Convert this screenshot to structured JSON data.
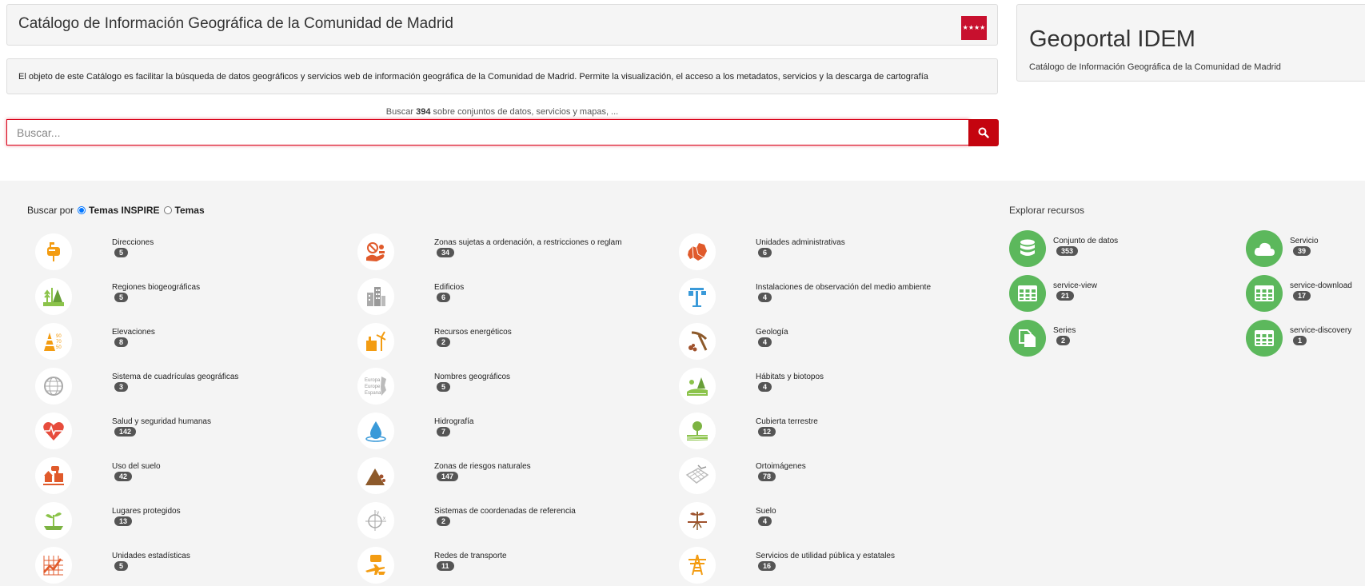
{
  "header": {
    "title": "Catálogo de Información Geográfica de la Comunidad de Madrid",
    "description": "El objeto de este Catálogo es facilitar la búsqueda de datos geográficos y servicios web de información geográfica de la Comunidad de Madrid. Permite la visualización, el acceso a los metadatos, servicios y la descarga de cartografía"
  },
  "geoportal": {
    "title": "Geoportal IDEM",
    "subtitle": "Catálogo de Información Geográfica de la Comunidad de Madrid"
  },
  "search": {
    "count_prefix": "Buscar",
    "count": "394",
    "count_suffix": "sobre conjuntos de datos, servicios y mapas, ...",
    "placeholder": "Buscar..."
  },
  "search_by": {
    "label": "Buscar por",
    "option_inspire": "Temas INSPIRE",
    "option_temas": "Temas"
  },
  "themes": [
    {
      "label": "Direcciones",
      "count": "5",
      "icon": "mailbox-icon"
    },
    {
      "label": "Zonas sujetas a ordenación, a restricciones o reglam",
      "count": "34",
      "icon": "restricted-zone-icon"
    },
    {
      "label": "Unidades administrativas",
      "count": "6",
      "icon": "admin-map-icon"
    },
    {
      "label": "Regiones biogeográficas",
      "count": "5",
      "icon": "biogeo-regions-icon"
    },
    {
      "label": "Edificios",
      "count": "6",
      "icon": "buildings-icon"
    },
    {
      "label": "Instalaciones de observación del medio ambiente",
      "count": "4",
      "icon": "observation-station-icon"
    },
    {
      "label": "Elevaciones",
      "count": "8",
      "icon": "elevation-icon"
    },
    {
      "label": "Recursos energéticos",
      "count": "2",
      "icon": "energy-icon"
    },
    {
      "label": "Geología",
      "count": "4",
      "icon": "pickaxe-icon"
    },
    {
      "label": "Sistema de cuadrículas geográficas",
      "count": "3",
      "icon": "grid-globe-icon"
    },
    {
      "label": "Nombres geográficos",
      "count": "5",
      "icon": "geo-names-icon"
    },
    {
      "label": "Hábitats y biotopos",
      "count": "4",
      "icon": "habitat-icon"
    },
    {
      "label": "Salud y seguridad humanas",
      "count": "142",
      "icon": "heart-icon"
    },
    {
      "label": "Hidrografía",
      "count": "7",
      "icon": "water-drop-icon"
    },
    {
      "label": "Cubierta terrestre",
      "count": "12",
      "icon": "land-cover-icon"
    },
    {
      "label": "Uso del suelo",
      "count": "42",
      "icon": "land-use-icon"
    },
    {
      "label": "Zonas de riesgos naturales",
      "count": "147",
      "icon": "landslide-icon"
    },
    {
      "label": "Ortoimágenes",
      "count": "78",
      "icon": "orthoimage-icon"
    },
    {
      "label": "Lugares protegidos",
      "count": "13",
      "icon": "protected-plant-icon"
    },
    {
      "label": "Sistemas de coordenadas de referencia",
      "count": "2",
      "icon": "coordinates-icon"
    },
    {
      "label": "Suelo",
      "count": "4",
      "icon": "soil-icon"
    },
    {
      "label": "Unidades estadísticas",
      "count": "5",
      "icon": "statistics-chart-icon"
    },
    {
      "label": "Redes de transporte",
      "count": "11",
      "icon": "transport-icon"
    },
    {
      "label": "Servicios de utilidad pública y estatales",
      "count": "16",
      "icon": "utility-tower-icon"
    }
  ],
  "explore": {
    "title": "Explorar recursos",
    "resources": [
      {
        "label": "Conjunto de datos",
        "count": "353",
        "icon": "database-icon"
      },
      {
        "label": "Servicio",
        "count": "39",
        "icon": "cloud-icon"
      },
      {
        "label": "service-view",
        "count": "21",
        "icon": "table-grid-icon"
      },
      {
        "label": "service-download",
        "count": "17",
        "icon": "table-grid-icon"
      },
      {
        "label": "Series",
        "count": "2",
        "icon": "copy-docs-icon"
      },
      {
        "label": "service-discovery",
        "count": "1",
        "icon": "table-grid-icon"
      }
    ]
  },
  "colors": {
    "accent_red": "#c4040f",
    "resource_green": "#5cb85c",
    "badge": "#555555",
    "theme_orange": "#f39c12",
    "theme_red": "#e05a2b"
  }
}
